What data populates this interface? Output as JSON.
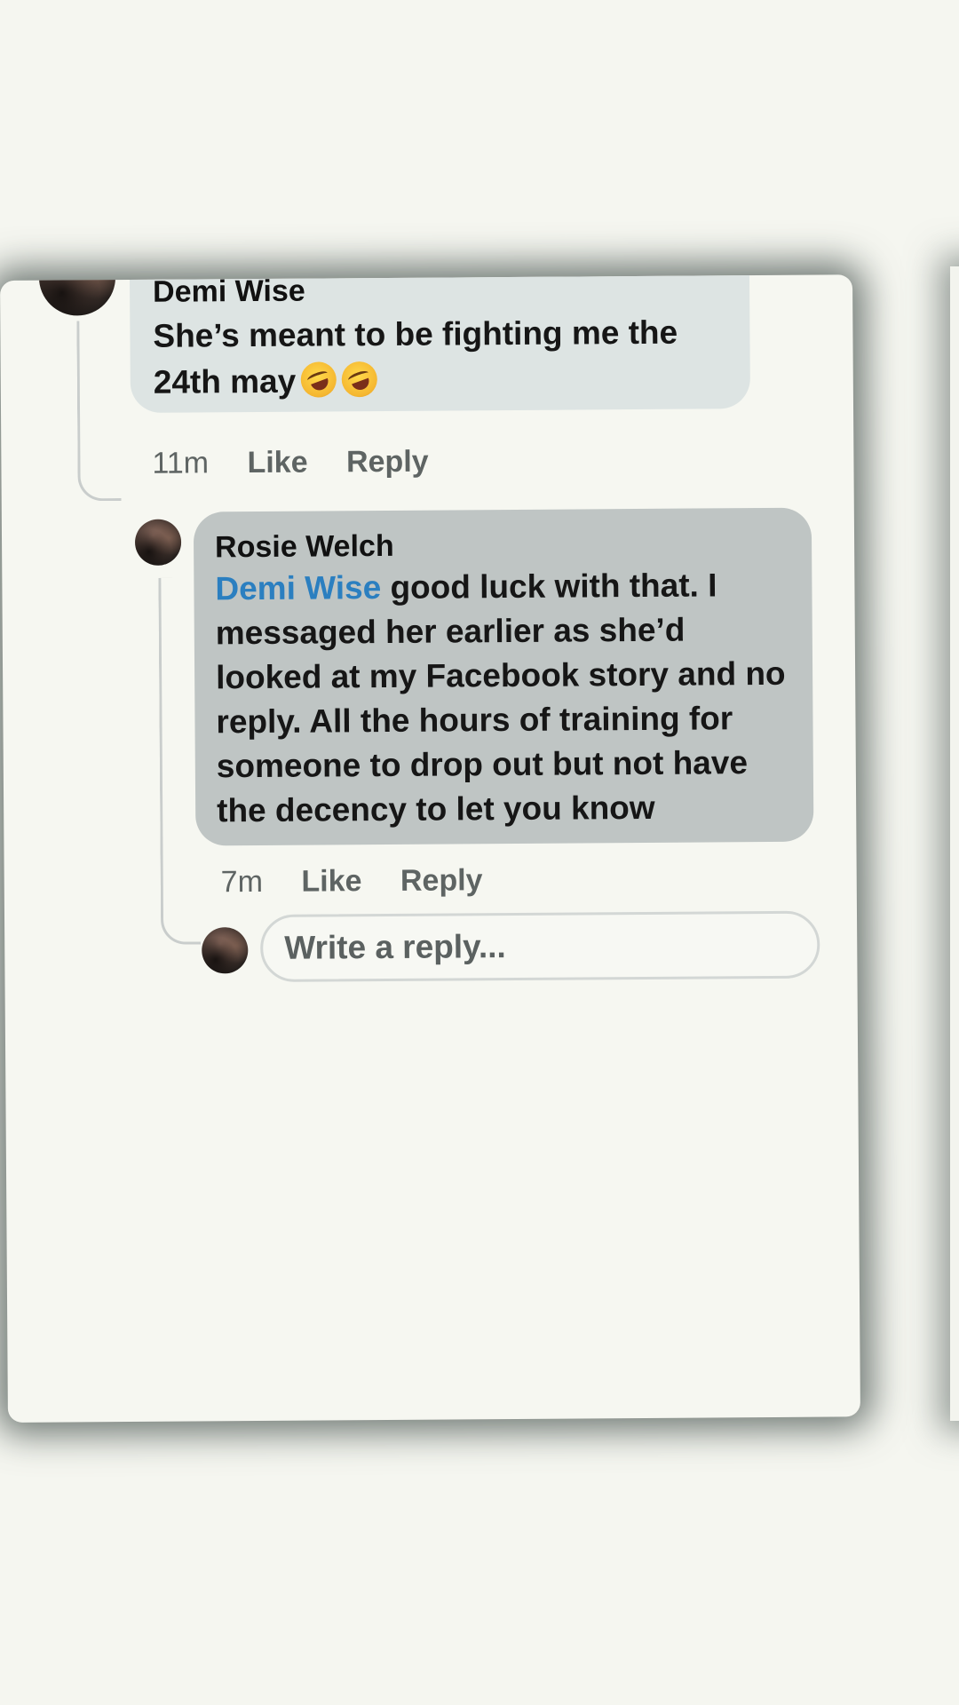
{
  "comments": [
    {
      "author": "Demi Wise",
      "text": "She’s meant to be fighting me the 24th may",
      "emoji": [
        "rolling-on-floor-laughing",
        "rolling-on-floor-laughing"
      ],
      "time": "11m",
      "like_label": "Like",
      "reply_label": "Reply"
    },
    {
      "author": "Rosie Welch",
      "mention": "Demi Wise",
      "text": " good luck with that. I messaged her earlier as she’d looked at my Facebook story and no reply. All the hours of training for someone to drop out but not have the decency to let you know",
      "time": "7m",
      "like_label": "Like",
      "reply_label": "Reply"
    }
  ],
  "reply_box": {
    "placeholder": "Write a reply..."
  },
  "colors": {
    "mention": "#2b7fc0",
    "bubble_light": "#dde4e3",
    "bubble_dark": "#bfc5c4",
    "meta": "#5e6463"
  }
}
